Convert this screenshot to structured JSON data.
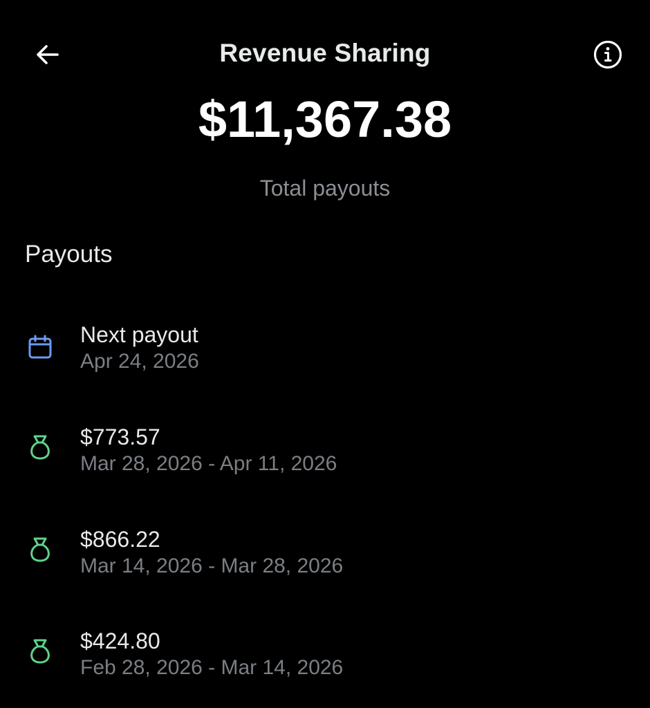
{
  "header": {
    "title": "Revenue Sharing",
    "back_icon": "arrow-left-icon",
    "info_icon": "info-circle-icon"
  },
  "summary": {
    "total_amount": "$11,367.38",
    "total_label": "Total payouts"
  },
  "payouts": {
    "heading": "Payouts",
    "next": {
      "icon": "calendar-icon",
      "icon_color": "#6a9bf4",
      "label": "Next payout",
      "date": "Apr 24, 2026"
    },
    "items": [
      {
        "icon": "money-bag-icon",
        "amount": "$773.57",
        "period": "Mar 28, 2026 - Apr 11, 2026"
      },
      {
        "icon": "money-bag-icon",
        "amount": "$866.22",
        "period": "Mar 14, 2026 - Mar 28, 2026"
      },
      {
        "icon": "money-bag-icon",
        "amount": "$424.80",
        "period": "Feb 28, 2026 - Mar 14, 2026"
      }
    ],
    "money_icon_color": "#5fd38a"
  },
  "colors": {
    "background": "#000000",
    "text_primary": "#e7e9ea",
    "text_secondary": "#7b7f84"
  }
}
